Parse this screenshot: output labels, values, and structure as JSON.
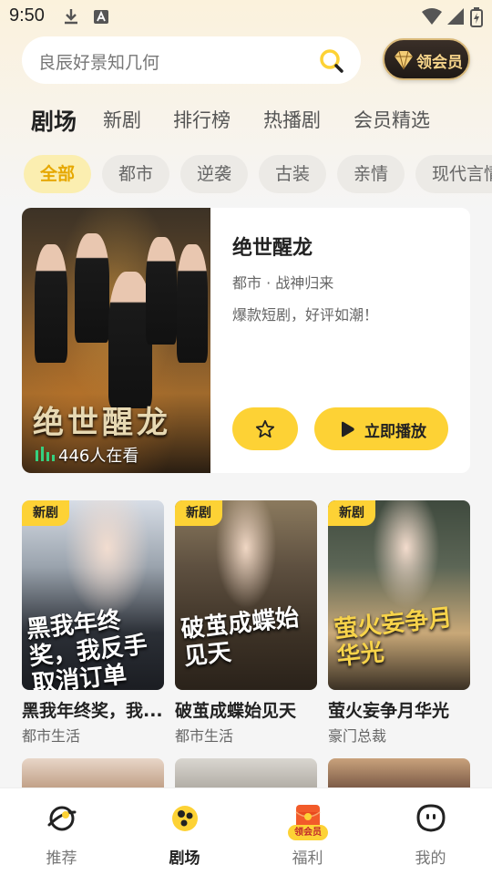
{
  "status_bar": {
    "time": "9:50"
  },
  "search": {
    "placeholder": "良辰好景知几何"
  },
  "vip": {
    "label": "领会员"
  },
  "tabs": [
    {
      "label": "剧场",
      "active": true
    },
    {
      "label": "新剧"
    },
    {
      "label": "排行榜"
    },
    {
      "label": "热播剧"
    },
    {
      "label": "会员精选"
    }
  ],
  "chips": [
    {
      "label": "全部",
      "active": true
    },
    {
      "label": "都市"
    },
    {
      "label": "逆袭"
    },
    {
      "label": "古装"
    },
    {
      "label": "亲情"
    },
    {
      "label": "现代言情"
    }
  ],
  "featured": {
    "poster_title": "绝世醒龙",
    "viewers": "446人在看",
    "title": "绝世醒龙",
    "tags": "都市 · 战神归来",
    "description": "爆款短剧，好评如潮！",
    "play_label": "立即播放"
  },
  "cards": [
    {
      "badge": "新剧",
      "poster_title": "黑我年终奖，我反手取消订单",
      "title": "黑我年终奖，我...",
      "category": "都市生活"
    },
    {
      "badge": "新剧",
      "poster_title": "破茧成蝶始见天",
      "title": "破茧成蝶始见天",
      "category": "都市生活"
    },
    {
      "badge": "新剧",
      "poster_title": "萤火妄争月华光",
      "title": "萤火妄争月华光",
      "category": "豪门总裁"
    }
  ],
  "bottom_nav": [
    {
      "label": "推荐"
    },
    {
      "label": "剧场",
      "active": true
    },
    {
      "label": "福利",
      "badge": "领会员"
    },
    {
      "label": "我的"
    }
  ],
  "colors": {
    "accent": "#fdd235",
    "accent_text": "#e6a800"
  }
}
